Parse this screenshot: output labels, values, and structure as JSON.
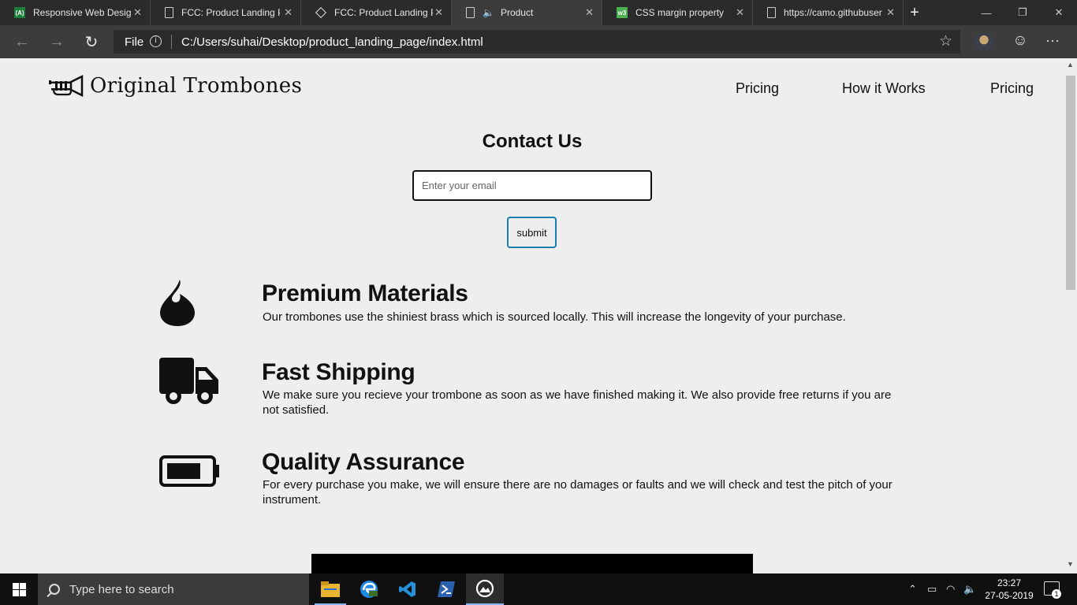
{
  "browser": {
    "tabs": [
      {
        "title": "Responsive Web Design",
        "icon": "freecodecamp-icon"
      },
      {
        "title": "FCC: Product Landing Page",
        "icon": "page-icon"
      },
      {
        "title": "FCC: Product Landing Page",
        "icon": "codepen-icon"
      },
      {
        "title": "Product",
        "icon": "page-icon",
        "active": true,
        "audio": true
      },
      {
        "title": "CSS margin property",
        "icon": "w3schools-icon"
      },
      {
        "title": "https://camo.githubusercontent.com",
        "icon": "page-icon"
      }
    ],
    "address": {
      "scheme_label": "File",
      "url": "C:/Users/suhai/Desktop/product_landing_page/index.html"
    }
  },
  "page": {
    "brand": "Original Trombones",
    "nav": [
      "Pricing",
      "How it Works",
      "Pricing"
    ],
    "contact": {
      "heading": "Contact Us",
      "email_placeholder": "Enter your email",
      "submit_label": "submit"
    },
    "features": [
      {
        "icon": "fire-icon",
        "title": "Premium Materials",
        "description": "Our trombones use the shiniest brass which is sourced locally. This will increase the longevity of your purchase."
      },
      {
        "icon": "truck-icon",
        "title": "Fast Shipping",
        "description": "We make sure you recieve your trombone as soon as we have finished making it. We also provide free returns if you are not satisfied."
      },
      {
        "icon": "battery-icon",
        "title": "Quality Assurance",
        "description": "For every purchase you make, we will ensure there are no damages or faults and we will check and test the pitch of your instrument."
      }
    ]
  },
  "taskbar": {
    "search_placeholder": "Type here to search",
    "time": "23:27",
    "date": "27-05-2019",
    "notification_count": "1"
  },
  "colors": {
    "page_background": "#eeeeee",
    "submit_border": "#1b7fae",
    "chrome_dark": "#2b2b2b"
  }
}
